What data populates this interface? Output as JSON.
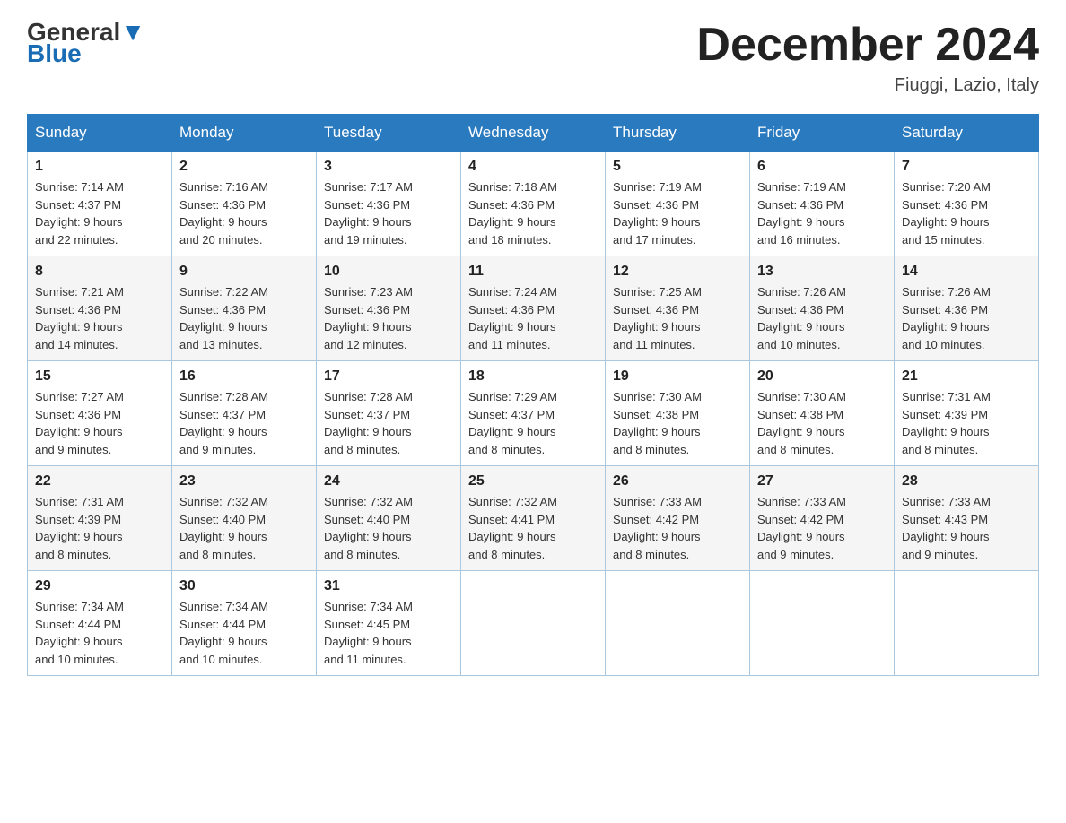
{
  "header": {
    "logo_general": "General",
    "logo_blue": "Blue",
    "month_title": "December 2024",
    "location": "Fiuggi, Lazio, Italy"
  },
  "columns": [
    "Sunday",
    "Monday",
    "Tuesday",
    "Wednesday",
    "Thursday",
    "Friday",
    "Saturday"
  ],
  "weeks": [
    [
      {
        "day": "1",
        "sunrise": "7:14 AM",
        "sunset": "4:37 PM",
        "daylight": "9 hours and 22 minutes."
      },
      {
        "day": "2",
        "sunrise": "7:16 AM",
        "sunset": "4:36 PM",
        "daylight": "9 hours and 20 minutes."
      },
      {
        "day": "3",
        "sunrise": "7:17 AM",
        "sunset": "4:36 PM",
        "daylight": "9 hours and 19 minutes."
      },
      {
        "day": "4",
        "sunrise": "7:18 AM",
        "sunset": "4:36 PM",
        "daylight": "9 hours and 18 minutes."
      },
      {
        "day": "5",
        "sunrise": "7:19 AM",
        "sunset": "4:36 PM",
        "daylight": "9 hours and 17 minutes."
      },
      {
        "day": "6",
        "sunrise": "7:19 AM",
        "sunset": "4:36 PM",
        "daylight": "9 hours and 16 minutes."
      },
      {
        "day": "7",
        "sunrise": "7:20 AM",
        "sunset": "4:36 PM",
        "daylight": "9 hours and 15 minutes."
      }
    ],
    [
      {
        "day": "8",
        "sunrise": "7:21 AM",
        "sunset": "4:36 PM",
        "daylight": "9 hours and 14 minutes."
      },
      {
        "day": "9",
        "sunrise": "7:22 AM",
        "sunset": "4:36 PM",
        "daylight": "9 hours and 13 minutes."
      },
      {
        "day": "10",
        "sunrise": "7:23 AM",
        "sunset": "4:36 PM",
        "daylight": "9 hours and 12 minutes."
      },
      {
        "day": "11",
        "sunrise": "7:24 AM",
        "sunset": "4:36 PM",
        "daylight": "9 hours and 11 minutes."
      },
      {
        "day": "12",
        "sunrise": "7:25 AM",
        "sunset": "4:36 PM",
        "daylight": "9 hours and 11 minutes."
      },
      {
        "day": "13",
        "sunrise": "7:26 AM",
        "sunset": "4:36 PM",
        "daylight": "9 hours and 10 minutes."
      },
      {
        "day": "14",
        "sunrise": "7:26 AM",
        "sunset": "4:36 PM",
        "daylight": "9 hours and 10 minutes."
      }
    ],
    [
      {
        "day": "15",
        "sunrise": "7:27 AM",
        "sunset": "4:36 PM",
        "daylight": "9 hours and 9 minutes."
      },
      {
        "day": "16",
        "sunrise": "7:28 AM",
        "sunset": "4:37 PM",
        "daylight": "9 hours and 9 minutes."
      },
      {
        "day": "17",
        "sunrise": "7:28 AM",
        "sunset": "4:37 PM",
        "daylight": "9 hours and 8 minutes."
      },
      {
        "day": "18",
        "sunrise": "7:29 AM",
        "sunset": "4:37 PM",
        "daylight": "9 hours and 8 minutes."
      },
      {
        "day": "19",
        "sunrise": "7:30 AM",
        "sunset": "4:38 PM",
        "daylight": "9 hours and 8 minutes."
      },
      {
        "day": "20",
        "sunrise": "7:30 AM",
        "sunset": "4:38 PM",
        "daylight": "9 hours and 8 minutes."
      },
      {
        "day": "21",
        "sunrise": "7:31 AM",
        "sunset": "4:39 PM",
        "daylight": "9 hours and 8 minutes."
      }
    ],
    [
      {
        "day": "22",
        "sunrise": "7:31 AM",
        "sunset": "4:39 PM",
        "daylight": "9 hours and 8 minutes."
      },
      {
        "day": "23",
        "sunrise": "7:32 AM",
        "sunset": "4:40 PM",
        "daylight": "9 hours and 8 minutes."
      },
      {
        "day": "24",
        "sunrise": "7:32 AM",
        "sunset": "4:40 PM",
        "daylight": "9 hours and 8 minutes."
      },
      {
        "day": "25",
        "sunrise": "7:32 AM",
        "sunset": "4:41 PM",
        "daylight": "9 hours and 8 minutes."
      },
      {
        "day": "26",
        "sunrise": "7:33 AM",
        "sunset": "4:42 PM",
        "daylight": "9 hours and 8 minutes."
      },
      {
        "day": "27",
        "sunrise": "7:33 AM",
        "sunset": "4:42 PM",
        "daylight": "9 hours and 9 minutes."
      },
      {
        "day": "28",
        "sunrise": "7:33 AM",
        "sunset": "4:43 PM",
        "daylight": "9 hours and 9 minutes."
      }
    ],
    [
      {
        "day": "29",
        "sunrise": "7:34 AM",
        "sunset": "4:44 PM",
        "daylight": "9 hours and 10 minutes."
      },
      {
        "day": "30",
        "sunrise": "7:34 AM",
        "sunset": "4:44 PM",
        "daylight": "9 hours and 10 minutes."
      },
      {
        "day": "31",
        "sunrise": "7:34 AM",
        "sunset": "4:45 PM",
        "daylight": "9 hours and 11 minutes."
      },
      null,
      null,
      null,
      null
    ]
  ],
  "labels": {
    "sunrise": "Sunrise:",
    "sunset": "Sunset:",
    "daylight": "Daylight:"
  }
}
